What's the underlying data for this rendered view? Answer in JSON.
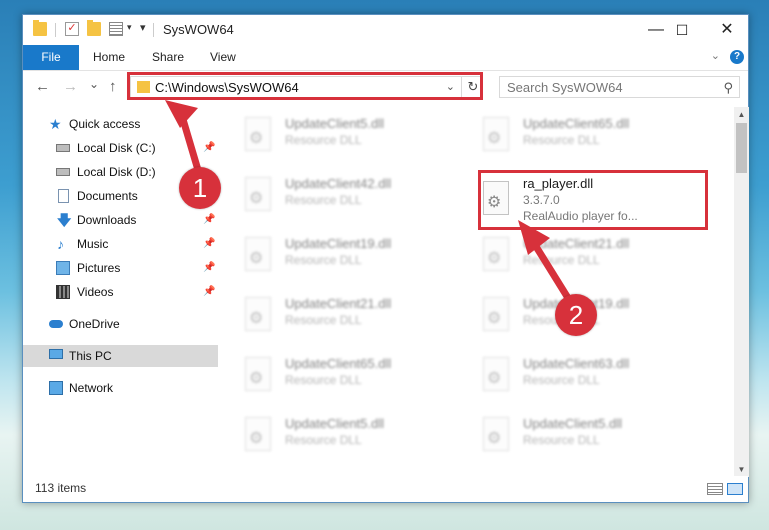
{
  "window": {
    "title": "SysWOW64"
  },
  "window_controls": {
    "minimize": "—",
    "maximize": "☐",
    "close": "✕"
  },
  "ribbon": {
    "file": "File",
    "tabs": [
      "Home",
      "Share",
      "View"
    ],
    "help": "?"
  },
  "nav": {
    "back": "←",
    "forward": "→",
    "recent": "⌄",
    "up": "↑",
    "address": "C:\\Windows\\SysWOW64",
    "address_dropdown": "⌄",
    "refresh": "↻",
    "search_placeholder": "Search SysWOW64",
    "search_icon": "⚲"
  },
  "sidebar": {
    "items": [
      {
        "label": "Quick access",
        "icon": "star-icon"
      },
      {
        "label": "Local Disk (C:)",
        "icon": "drive-icon",
        "pinned": true
      },
      {
        "label": "Local Disk (D:)",
        "icon": "drive-icon"
      },
      {
        "label": "Documents",
        "icon": "documents-icon"
      },
      {
        "label": "Downloads",
        "icon": "download-icon",
        "pinned": true
      },
      {
        "label": "Music",
        "icon": "music-icon",
        "pinned": true
      },
      {
        "label": "Pictures",
        "icon": "pictures-icon",
        "pinned": true
      },
      {
        "label": "Videos",
        "icon": "videos-icon",
        "pinned": true
      },
      {
        "label": "OneDrive",
        "icon": "onedrive-icon"
      },
      {
        "label": "This PC",
        "icon": "pc-icon",
        "selected": true
      },
      {
        "label": "Network",
        "icon": "network-icon"
      }
    ],
    "pin_glyph": "📌"
  },
  "files": {
    "left": [
      {
        "name": "UpdateClient5.dll",
        "desc": "Resource DLL"
      },
      {
        "name": "UpdateClient42.dll",
        "desc": "Resource DLL"
      },
      {
        "name": "UpdateClient19.dll",
        "desc": "Resource DLL"
      },
      {
        "name": "UpdateClient21.dll",
        "desc": "Resource DLL"
      },
      {
        "name": "UpdateClient65.dll",
        "desc": "Resource DLL"
      },
      {
        "name": "UpdateClient5.dll",
        "desc": "Resource DLL"
      }
    ],
    "right": [
      {
        "name": "UpdateClient65.dll",
        "desc": "Resource DLL"
      },
      {
        "name": "UpdateClient21.dll",
        "desc": "Resource DLL"
      },
      {
        "name": "UpdateClient19.dll",
        "desc": "Resource DLL"
      },
      {
        "name": "UpdateClient63.dll",
        "desc": "Resource DLL"
      },
      {
        "name": "UpdateClient5.dll",
        "desc": "Resource DLL"
      }
    ],
    "highlighted": {
      "name": "ra_player.dll",
      "version": "3.3.7.0",
      "desc": "RealAudio player fo..."
    }
  },
  "scrollbar": {
    "up": "▲",
    "down": "▼"
  },
  "status": {
    "items": "113 items"
  },
  "callouts": {
    "one": "1",
    "two": "2"
  },
  "colors": {
    "accent": "#1979ca",
    "annotation": "#d7313b"
  }
}
